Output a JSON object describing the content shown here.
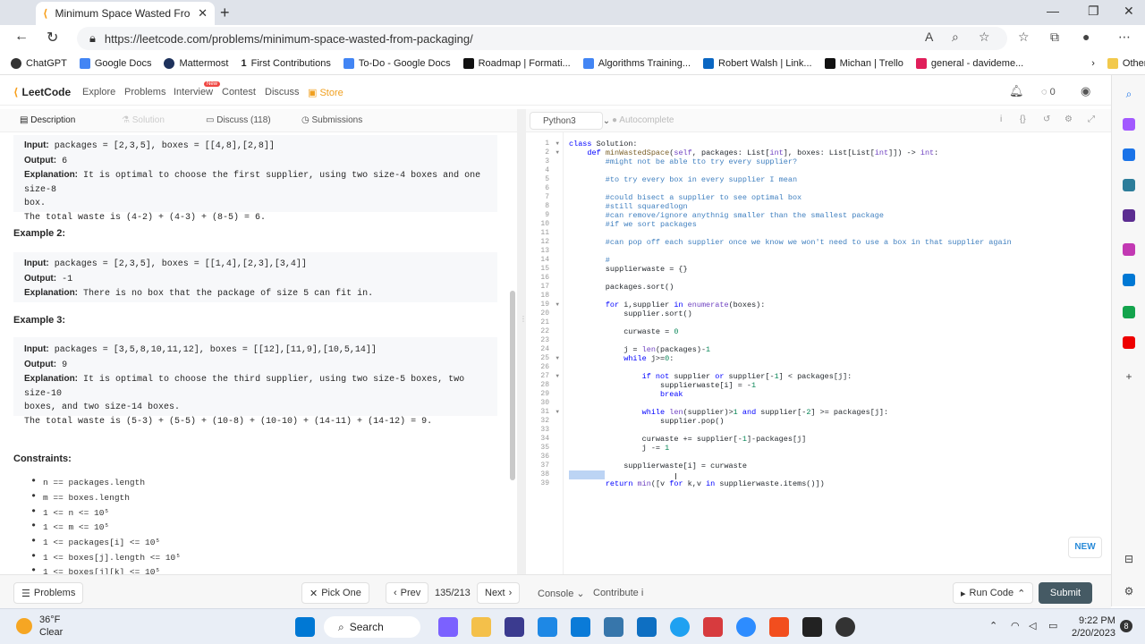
{
  "browser": {
    "tab_title": "Minimum Space Wasted From Pa",
    "url": "https://leetcode.com/problems/minimum-space-wasted-from-packaging/",
    "bookmarks": [
      "ChatGPT",
      "Google Docs",
      "Mattermost",
      "First Contributions",
      "To-Do - Google Docs",
      "Roadmap | Formati...",
      "Algorithms Training...",
      "Robert Walsh | Link...",
      "Michan | Trello",
      "general - davideme..."
    ],
    "other_favorites": "Other favorites"
  },
  "lc_header": {
    "logo": "LeetCode",
    "nav": [
      "Explore",
      "Problems",
      "Interview",
      "Contest",
      "Discuss",
      "Store"
    ],
    "new_badge": "New",
    "coins": "0"
  },
  "left_tabs": [
    "Description",
    "Solution",
    "Discuss (118)",
    "Submissions"
  ],
  "examples": {
    "ex1": {
      "input_label": "Input:",
      "input": "packages = [2,3,5], boxes = [[4,8],[2,8]]",
      "output_label": "Output:",
      "output": "6",
      "expl_label": "Explanation:",
      "expl": "It is optimal to choose the first supplier, using two size-4 boxes and one size-8",
      "expl2": "box.",
      "expl3": "The total waste is (4-2) + (4-3) + (8-5) = 6."
    },
    "ex2": {
      "heading": "Example 2:",
      "input_label": "Input:",
      "input": "packages = [2,3,5], boxes = [[1,4],[2,3],[3,4]]",
      "output_label": "Output:",
      "output": "-1",
      "expl_label": "Explanation:",
      "expl": "There is no box that the package of size 5 can fit in."
    },
    "ex3": {
      "heading": "Example 3:",
      "input_label": "Input:",
      "input": "packages = [3,5,8,10,11,12], boxes = [[12],[11,9],[10,5,14]]",
      "output_label": "Output:",
      "output": "9",
      "expl_label": "Explanation:",
      "expl": "It is optimal to choose the third supplier, using two size-5 boxes, two size-10",
      "expl2": "boxes, and two size-14 boxes.",
      "expl3": "The total waste is (5-3) + (5-5) + (10-8) + (10-10) + (14-11) + (14-12) = 9."
    }
  },
  "constraints": {
    "heading": "Constraints:",
    "items": [
      "n == packages.length",
      "m == boxes.length",
      "1 <= n <= 10⁵",
      "1 <= m <= 10⁵",
      "1 <= packages[i] <= 10⁵",
      "1 <= boxes[j].length <= 10⁵",
      "1 <= boxes[j][k] <= 10⁵"
    ]
  },
  "editor": {
    "language": "Python3",
    "autocomplete": "Autocomplete",
    "line_numbers": [
      "1",
      "2",
      "3",
      "4",
      "5",
      "6",
      "7",
      "8",
      "9",
      "10",
      "11",
      "12",
      "13",
      "14",
      "15",
      "16",
      "17",
      "18",
      "19",
      "20",
      "21",
      "22",
      "23",
      "24",
      "25",
      "26",
      "27",
      "28",
      "29",
      "30",
      "31",
      "32",
      "33",
      "34",
      "35",
      "36",
      "37",
      "38",
      "39"
    ]
  },
  "bottom": {
    "problems": "Problems",
    "pick_one": "Pick One",
    "prev": "Prev",
    "page": "135/213",
    "next": "Next",
    "console": "Console",
    "contribute": "Contribute",
    "run_code": "Run Code",
    "submit": "Submit",
    "new_pill": "NEW"
  },
  "taskbar": {
    "temp": "36°F",
    "weather": "Clear",
    "search": "Search",
    "time": "9:22 PM",
    "date": "2/20/2023",
    "notif": "8"
  }
}
